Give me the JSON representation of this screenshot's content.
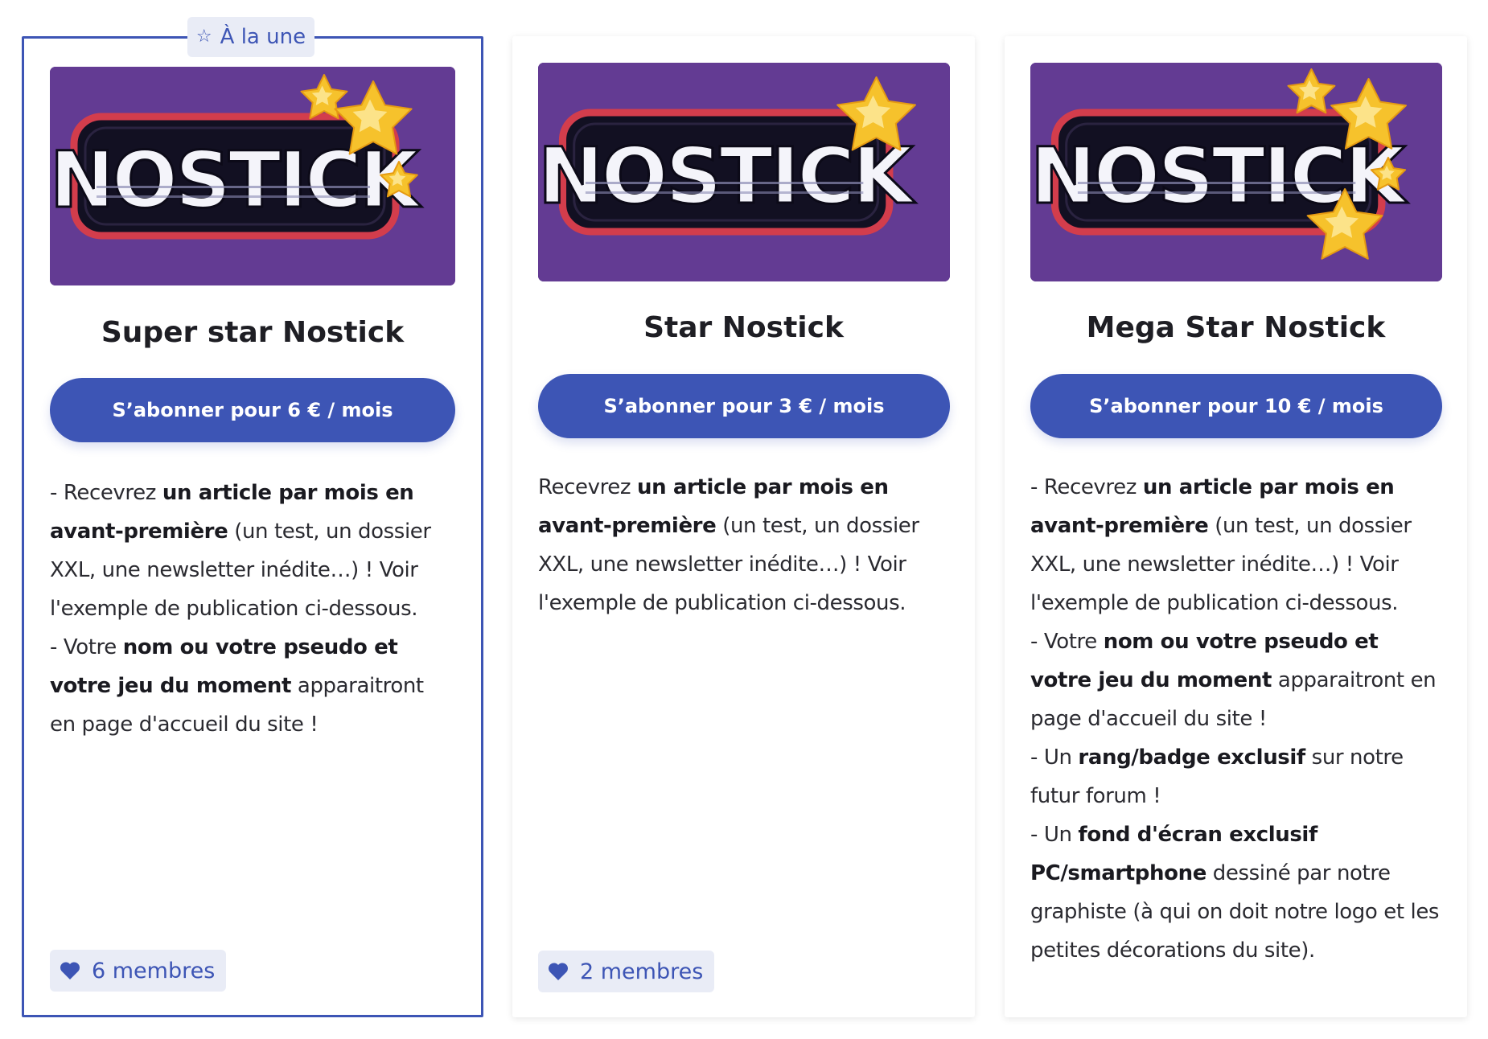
{
  "featured_badge": {
    "label": "À la une",
    "icon": "star-outline-icon"
  },
  "logo_text": "NOSTICK",
  "tiers": [
    {
      "title": "Super star Nostick",
      "button_label": "S’abonner pour 6 € / mois",
      "members": "6 membres",
      "stars": 3,
      "description": [
        {
          "segments": [
            {
              "text": "- Recevrez ",
              "bold": false
            },
            {
              "text": "un article par mois en avant-première",
              "bold": true
            },
            {
              "text": " (un test, un dossier XXL, une newsletter inédite…) ! Voir l'exemple de publication ci-dessous.",
              "bold": false
            }
          ]
        },
        {
          "segments": [
            {
              "text": "- Votre ",
              "bold": false
            },
            {
              "text": "nom ou votre pseudo et votre jeu du moment",
              "bold": true
            },
            {
              "text": " apparaitront en page d'accueil du site !",
              "bold": false
            }
          ]
        }
      ]
    },
    {
      "title": "Star Nostick",
      "button_label": "S’abonner pour 3 € / mois",
      "members": "2 membres",
      "stars": 1,
      "description": [
        {
          "segments": [
            {
              "text": "Recevrez ",
              "bold": false
            },
            {
              "text": "un article par mois en avant-première",
              "bold": true
            },
            {
              "text": " (un test, un dossier XXL, une newsletter inédite…) ! Voir l'exemple de publication ci-dessous.",
              "bold": false
            }
          ]
        }
      ]
    },
    {
      "title": "Mega Star Nostick",
      "button_label": "S’abonner pour 10 € / mois",
      "members": "",
      "stars": 4,
      "description": [
        {
          "segments": [
            {
              "text": "- Recevrez ",
              "bold": false
            },
            {
              "text": "un article par mois en avant-première",
              "bold": true
            },
            {
              "text": " (un test, un dossier XXL, une newsletter inédite…) ! Voir l'exemple de publication ci-dessous.",
              "bold": false
            }
          ]
        },
        {
          "segments": [
            {
              "text": "- Votre ",
              "bold": false
            },
            {
              "text": "nom ou votre pseudo et votre jeu du moment",
              "bold": true
            },
            {
              "text": " apparaitront en page d'accueil du site !",
              "bold": false
            }
          ]
        },
        {
          "segments": [
            {
              "text": "- Un ",
              "bold": false
            },
            {
              "text": "rang/badge exclusif",
              "bold": true
            },
            {
              "text": " sur notre futur forum !",
              "bold": false
            }
          ]
        },
        {
          "segments": [
            {
              "text": "- Un ",
              "bold": false
            },
            {
              "text": "fond d'écran exclusif PC/smartphone",
              "bold": true
            },
            {
              "text": " dessiné par notre graphiste (à qui on doit notre logo et les petites décorations du site).",
              "bold": false
            }
          ]
        }
      ]
    }
  ],
  "colors": {
    "accent": "#3d55b5",
    "badge_bg": "#e9ecf6",
    "logo_bg": "#633b93",
    "logo_border": "#d33d4c",
    "star": "#f6c22c"
  }
}
